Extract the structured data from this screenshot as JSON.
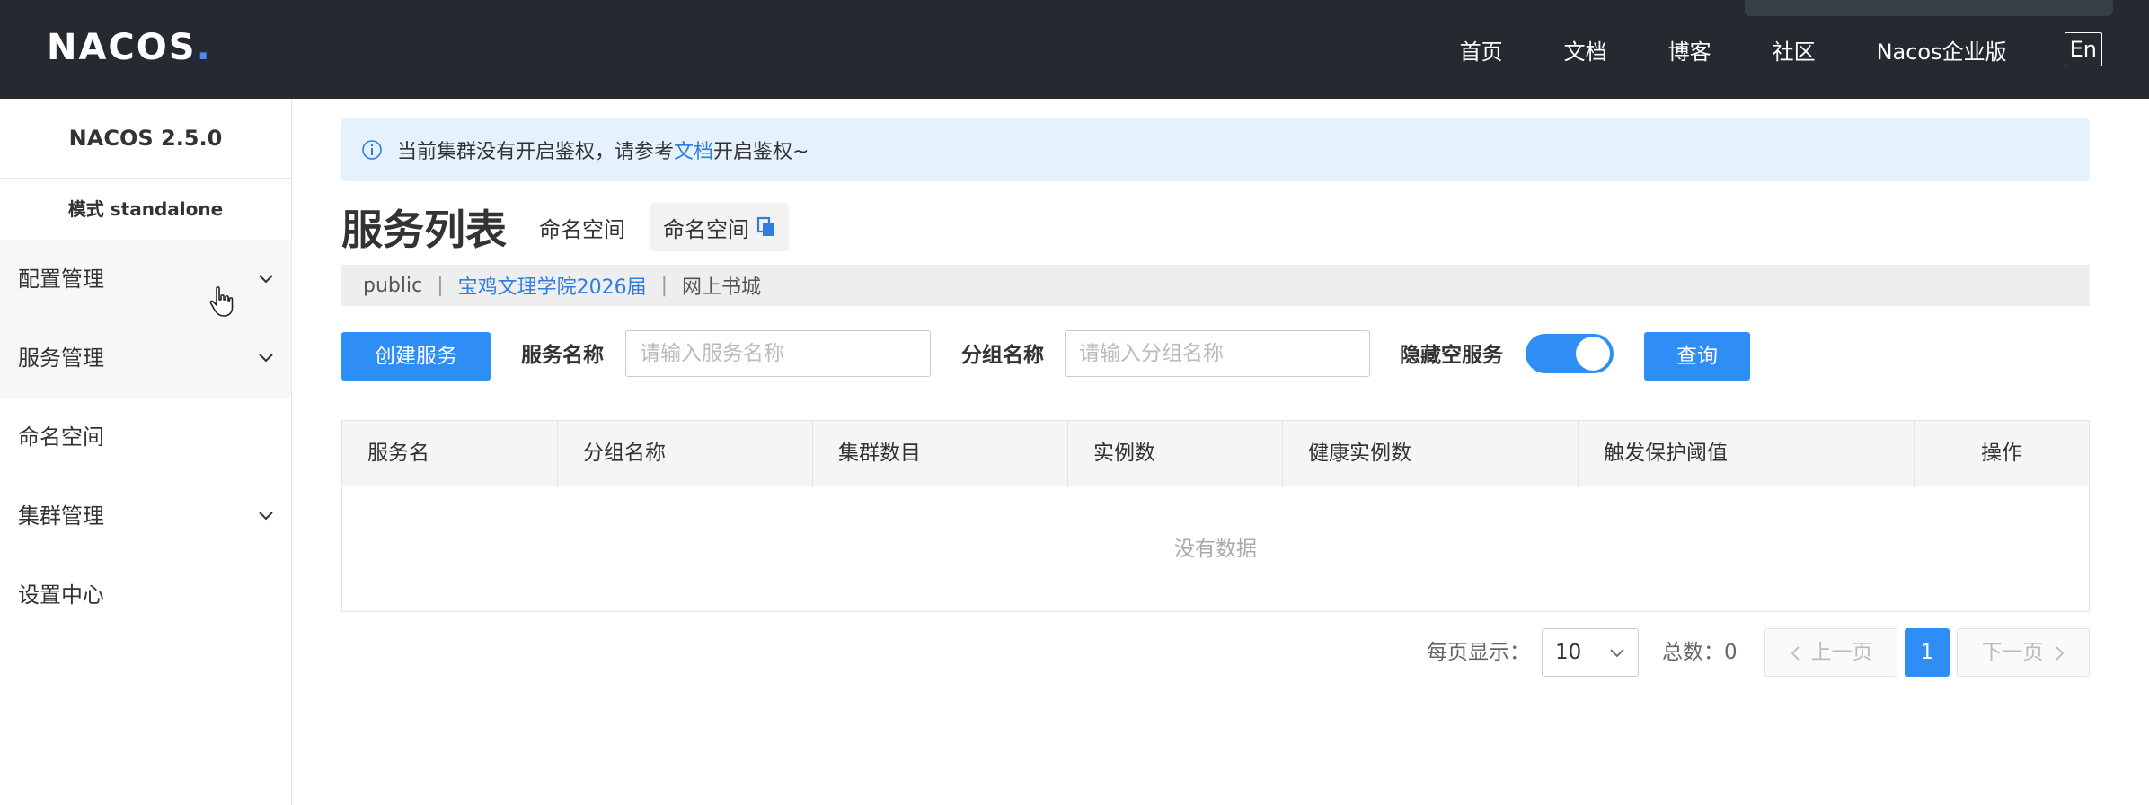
{
  "header": {
    "logo": "NACOS",
    "nav": [
      "首页",
      "文档",
      "博客",
      "社区",
      "Nacos企业版"
    ],
    "lang": "En"
  },
  "sidebar": {
    "version": "NACOS 2.5.0",
    "mode": "模式 standalone",
    "items": [
      {
        "label": "配置管理",
        "icon": "chevron-down-icon"
      },
      {
        "label": "服务管理",
        "icon": "chevron-down-icon"
      },
      {
        "label": "命名空间"
      },
      {
        "label": "集群管理",
        "icon": "chevron-down-icon"
      },
      {
        "label": "设置中心"
      }
    ]
  },
  "notice": {
    "prefix": "当前集群没有开启鉴权，请参考",
    "link": "文档",
    "suffix": "开启鉴权~"
  },
  "page": {
    "title": "服务列表",
    "namespace_label": "命名空间",
    "namespace_chip": "命名空间"
  },
  "namespaces": [
    "public",
    "宝鸡文理学院2026届",
    "网上书城"
  ],
  "filters": {
    "create_button": "创建服务",
    "service_name_label": "服务名称",
    "service_name_placeholder": "请输入服务名称",
    "group_name_label": "分组名称",
    "group_name_placeholder": "请输入分组名称",
    "hide_empty_label": "隐藏空服务",
    "hide_empty_on": true,
    "query_button": "查询"
  },
  "table": {
    "columns": [
      "服务名",
      "分组名称",
      "集群数目",
      "实例数",
      "健康实例数",
      "触发保护阈值",
      "操作"
    ],
    "empty_text": "没有数据"
  },
  "pagination": {
    "per_page_label": "每页显示：",
    "per_page_value": "10",
    "total_label": "总数：",
    "total": "0",
    "prev": "上一页",
    "current_page": "1",
    "next": "下一页"
  },
  "colors": {
    "topbar": "#252a31",
    "primary": "#2f8ef5",
    "link": "#2f7de1",
    "notice_bg": "#e5f1fd"
  }
}
